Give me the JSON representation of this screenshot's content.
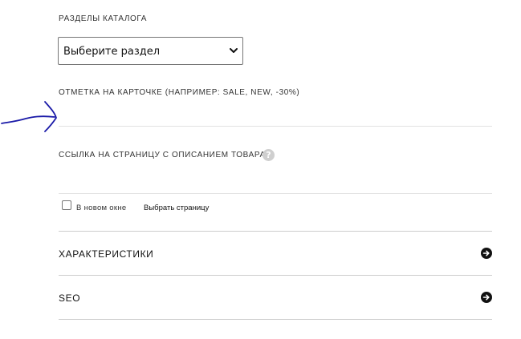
{
  "catalog": {
    "label": "РАЗДЕЛЫ КАТАЛОГА",
    "select_value": "Выберите раздел"
  },
  "badge": {
    "label": "ОТМЕТКА НА КАРТОЧКЕ (НАПРИМЕР: SALE, NEW, -30%)",
    "value": ""
  },
  "product_link": {
    "label": "ССЫЛКА НА СТРАНИЦУ С ОПИСАНИЕМ ТОВАРА",
    "help_glyph": "?",
    "value": "",
    "new_window_label": "В новом окне",
    "new_window_checked": false,
    "choose_page_label": "Выбрать страницу"
  },
  "accordion": {
    "characteristics": "ХАРАКТЕРИСТИКИ",
    "seo": "SEO"
  },
  "colors": {
    "annotation": "#1a1aa8",
    "divider": "#cccccc",
    "help_icon": "#cfcfcf"
  },
  "icons": {
    "select": "chevron-down-icon",
    "help": "question-icon",
    "accordion": "arrow-right-circle-icon",
    "annotation": "hand-drawn-arrow"
  }
}
